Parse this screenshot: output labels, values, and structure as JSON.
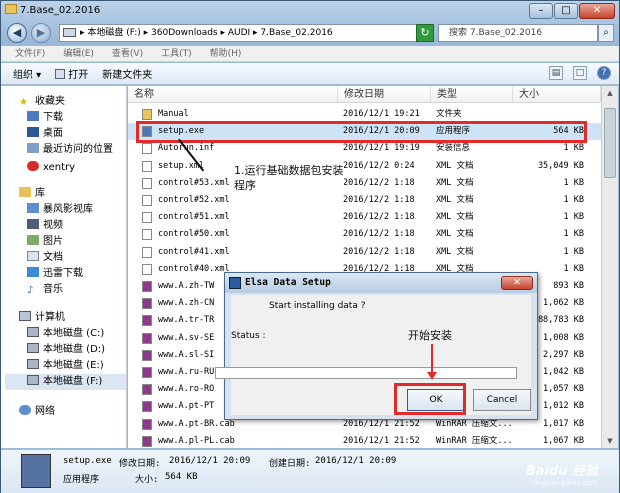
{
  "window": {
    "title": "7.Base_02.2016",
    "controls": [
      "–",
      "□",
      "✕"
    ]
  },
  "address_bar": {
    "path": "▸ 本地磁盘 (F:) ▸ 360Downloads ▸ AUDI ▸ 7.Base_02.2016",
    "search_placeholder": "搜索 7.Base_02.2016"
  },
  "menu": [
    "文件(F)",
    "编辑(E)",
    "查看(V)",
    "工具(T)",
    "帮助(H)"
  ],
  "toolbar": {
    "organize": "组织 ▾",
    "open": "打开",
    "new_folder": "新建文件夹"
  },
  "nav": {
    "favorites_header": "收藏夹",
    "favorites": [
      "下载",
      "桌面",
      "最近访问的位置"
    ],
    "xentry": "xentry",
    "library_header": "库",
    "library": [
      "暴风影视库",
      "视频",
      "图片",
      "文档",
      "迅雷下载",
      "音乐"
    ],
    "computer_header": "计算机",
    "drives": [
      "本地磁盘 (C:)",
      "本地磁盘 (D:)",
      "本地磁盘 (E:)",
      "本地磁盘 (F:)"
    ],
    "network": "网络"
  },
  "columns": [
    "名称",
    "修改日期",
    "类型",
    "大小"
  ],
  "files": [
    {
      "name": "Manual",
      "date": "2016/12/1 19:21",
      "type": "文件夹",
      "size": ""
    },
    {
      "name": "setup.exe",
      "date": "2016/12/1 20:09",
      "type": "应用程序",
      "size": "564 KB"
    },
    {
      "name": "Autorun.inf",
      "date": "2016/12/1 19:19",
      "type": "安装信息",
      "size": "1 KB"
    },
    {
      "name": "setup.xml",
      "date": "2016/12/2 0:24",
      "type": "XML 文档",
      "size": "35,049 KB"
    },
    {
      "name": "control#53.xml",
      "date": "2016/12/2 1:18",
      "type": "XML 文档",
      "size": "1 KB"
    },
    {
      "name": "control#52.xml",
      "date": "2016/12/2 1:18",
      "type": "XML 文档",
      "size": "1 KB"
    },
    {
      "name": "control#51.xml",
      "date": "2016/12/2 1:18",
      "type": "XML 文档",
      "size": "1 KB"
    },
    {
      "name": "control#50.xml",
      "date": "2016/12/2 1:18",
      "type": "XML 文档",
      "size": "1 KB"
    },
    {
      "name": "control#41.xml",
      "date": "2016/12/2 1:18",
      "type": "XML 文档",
      "size": "1 KB"
    },
    {
      "name": "control#40.xml",
      "date": "2016/12/2 1:18",
      "type": "XML 文档",
      "size": "1 KB"
    },
    {
      "name": "www.A.zh-TW",
      "date": "",
      "type": "",
      "size": "893 KB"
    },
    {
      "name": "www.A.zh-CN",
      "date": "",
      "type": "",
      "size": "1,062 KB"
    },
    {
      "name": "www.A.tr-TR",
      "date": "",
      "type": "",
      "size": "88,783 KB"
    },
    {
      "name": "www.A.sv-SE",
      "date": "",
      "type": "",
      "size": "1,008 KB"
    },
    {
      "name": "www.A.sl-SI",
      "date": "",
      "type": "",
      "size": "2,297 KB"
    },
    {
      "name": "www.A.ru-RU",
      "date": "",
      "type": "",
      "size": "1,042 KB"
    },
    {
      "name": "www.A.ro-RO",
      "date": "",
      "type": "",
      "size": "1,057 KB"
    },
    {
      "name": "www.A.pt-PT",
      "date": "",
      "type": "",
      "size": "1,012 KB"
    },
    {
      "name": "www.A.pt-BR.cab",
      "date": "2016/12/1 21:52",
      "type": "WinRAR 压缩文...",
      "size": "1,017 KB"
    },
    {
      "name": "www.A.pl-PL.cab",
      "date": "2016/12/1 21:52",
      "type": "WinRAR 压缩文...",
      "size": "1,067 KB"
    }
  ],
  "details": {
    "name": "setup.exe",
    "modified_label": "修改日期:",
    "modified": "2016/12/1 20:09",
    "created_label": "创建日期:",
    "created": "2016/12/1 20:09",
    "type": "应用程序",
    "size_label": "大小:",
    "size": "564 KB"
  },
  "annotations": {
    "step1": "1.运行基础数据包安装程序",
    "step2": "开始安装"
  },
  "dialog": {
    "title": "Elsa Data Setup",
    "message": "Start installing data ?",
    "status_label": "Status :",
    "progress": 0,
    "ok": "OK",
    "cancel": "Cancel"
  },
  "watermark": {
    "main": "Baidu 经验",
    "sub": "jingyan.baidu.com"
  }
}
